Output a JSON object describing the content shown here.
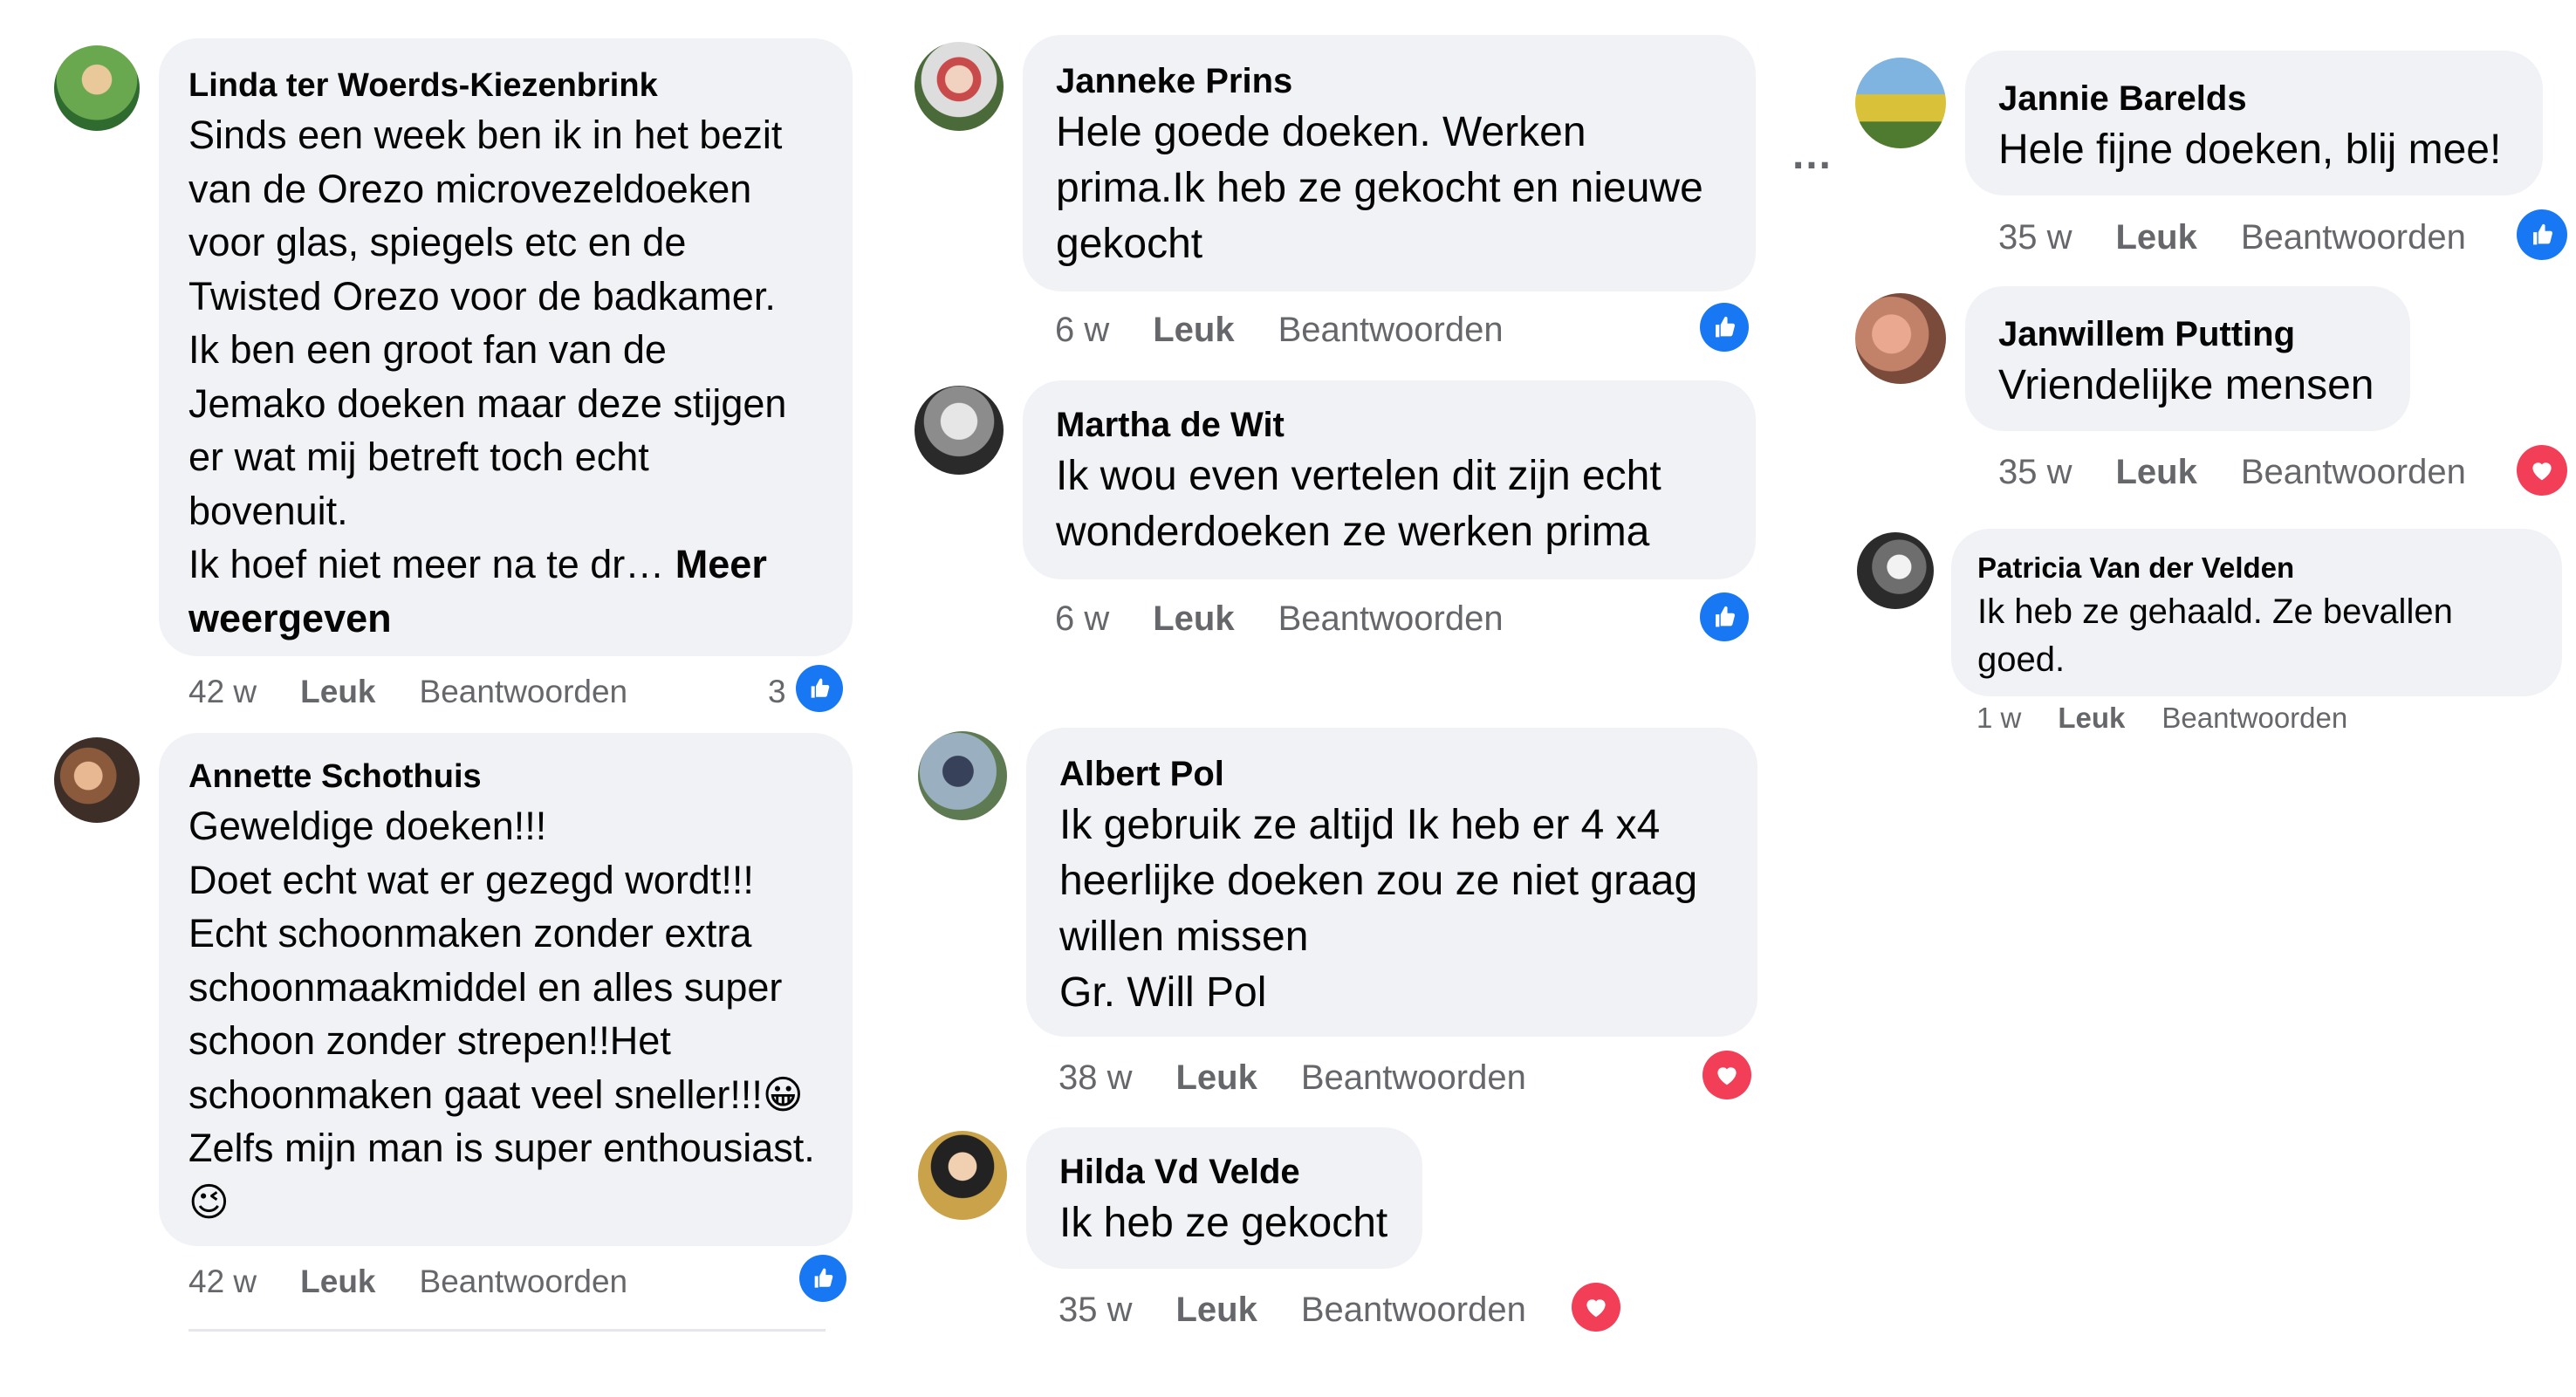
{
  "comments": [
    {
      "name": "Linda ter Woerds-Kiezenbrink",
      "text": "Sinds een week ben ik in het bezit\nvan de Orezo microvezeldoeken\nvoor glas, spiegels etc en de\nTwisted Orezo voor de badkamer.\nIk ben een groot fan van de\nJemako doeken maar deze stijgen\ner wat mij betreft toch echt\nbovenuit.",
      "text_tail": "Ik hoef niet meer na te dr…",
      "more": "Meer\nweergeven",
      "time": "42 w",
      "like": "Leuk",
      "reply": "Beantwoorden",
      "reaction": "like",
      "reaction_count": "3"
    },
    {
      "name": "Annette Schothuis",
      "text": "Geweldige doeken!!!\nDoet echt wat er gezegd wordt!!!\nEcht schoonmaken zonder extra\nschoonmaakmiddel en alles super\nschoon zonder strepen!!Het\nschoonmaken gaat veel sneller!!!😀\nZelfs mijn man is super enthousiast.\n😉",
      "time": "42 w",
      "like": "Leuk",
      "reply": "Beantwoorden",
      "reaction": "like"
    },
    {
      "name": "Janneke Prins",
      "text": "Hele goede doeken. Werken\nprima.Ik heb ze gekocht en nieuwe\ngekocht",
      "time": "6 w",
      "like": "Leuk",
      "reply": "Beantwoorden",
      "reaction": "like"
    },
    {
      "name": "Martha de Wit",
      "text": "Ik wou even vertelen dit zijn echt\nwonderdoeken ze werken prima",
      "time": "6 w",
      "like": "Leuk",
      "reply": "Beantwoorden",
      "reaction": "like"
    },
    {
      "name": "Albert Pol",
      "text": "Ik gebruik ze altijd Ik heb er 4 x4\nheerlijke doeken zou ze niet graag\nwillen missen\nGr. Will Pol",
      "time": "38 w",
      "like": "Leuk",
      "reply": "Beantwoorden",
      "reaction": "love"
    },
    {
      "name": "Hilda Vd Velde",
      "text": "Ik heb ze gekocht",
      "time": "35 w",
      "like": "Leuk",
      "reply": "Beantwoorden",
      "reaction": "love"
    },
    {
      "name": "Jannie Barelds",
      "text": "Hele fijne doeken, blij mee!",
      "time": "35 w",
      "like": "Leuk",
      "reply": "Beantwoorden",
      "reaction": "like"
    },
    {
      "name": "Janwillem Putting",
      "text": "Vriendelijke mensen",
      "time": "35 w",
      "like": "Leuk",
      "reply": "Beantwoorden",
      "reaction": "love"
    },
    {
      "name": "Patricia Van der Velden",
      "text": "Ik heb ze gehaald. Ze bevallen\ngoed.",
      "time": "1 w",
      "like": "Leuk",
      "reply": "Beantwoorden"
    }
  ],
  "more_options": "…",
  "colors": {
    "bubble": "#f0f2f5",
    "meta": "#65676b",
    "like": "#1877f2",
    "love": "#f33e58"
  }
}
